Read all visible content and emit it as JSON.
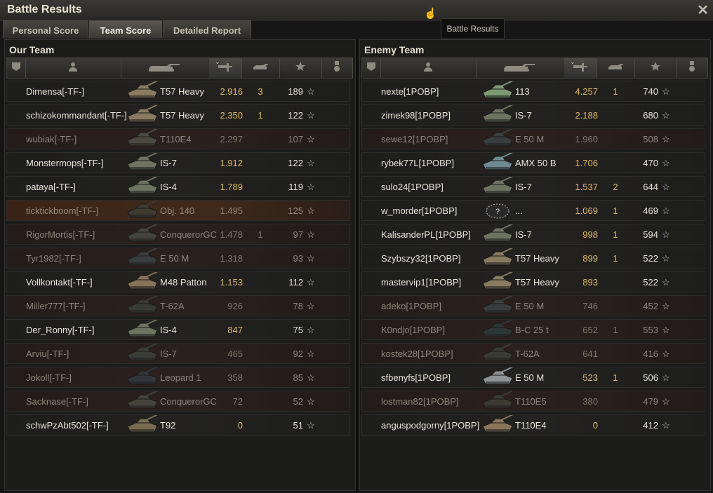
{
  "window": {
    "title": "Battle Results",
    "tooltip": "Battle Results"
  },
  "tabs": [
    {
      "label": "Personal Score",
      "active": false
    },
    {
      "label": "Team Score",
      "active": true
    },
    {
      "label": "Detailed Report",
      "active": false
    }
  ],
  "columns": [
    "rank-icon",
    "player-icon",
    "tank-icon",
    "damage-icon",
    "frags-icon",
    "xp-star-icon",
    "medal-icon"
  ],
  "teams": [
    {
      "title": "Our Team",
      "rows": [
        {
          "name": "Dimensa[-TF-]",
          "tank": "T57 Heavy",
          "damage": "2.916",
          "frags": "3",
          "xp": "189",
          "state": "alive",
          "tank_color": "#8a7a60"
        },
        {
          "name": "schizokommandant[-TF-]",
          "tank": "T57 Heavy",
          "damage": "2.350",
          "frags": "1",
          "xp": "122",
          "state": "alive",
          "tank_color": "#8a7a60"
        },
        {
          "name": "wubiak[-TF-]",
          "tank": "T110E4",
          "damage": "2.297",
          "frags": "",
          "xp": "107",
          "state": "dead",
          "tank_color": "#4a4a40"
        },
        {
          "name": "Monstermops[-TF-]",
          "tank": "IS-7",
          "damage": "1.912",
          "frags": "",
          "xp": "122",
          "state": "alive",
          "tank_color": "#6d7360"
        },
        {
          "name": "pataya[-TF-]",
          "tank": "IS-4",
          "damage": "1.789",
          "frags": "",
          "xp": "119",
          "state": "alive",
          "tank_color": "#6d7360"
        },
        {
          "name": "ticktickboom[-TF-]",
          "tank": "Obj. 140",
          "damage": "1.495",
          "frags": "",
          "xp": "125",
          "state": "me",
          "tank_color": "#3d3a32"
        },
        {
          "name": "RigorMortis[-TF-]",
          "tank": "ConquerorGC",
          "damage": "1.478",
          "frags": "1",
          "xp": "97",
          "state": "dead",
          "tank_color": "#44443c"
        },
        {
          "name": "Tyr1982[-TF-]",
          "tank": "E 50 M",
          "damage": "1.318",
          "frags": "",
          "xp": "93",
          "state": "dead",
          "tank_color": "#3a3d40"
        },
        {
          "name": "Vollkontakt[-TF-]",
          "tank": "M48 Patton",
          "damage": "1.153",
          "frags": "",
          "xp": "112",
          "state": "alive",
          "tank_color": "#8a7258"
        },
        {
          "name": "Miller777[-TF-]",
          "tank": "T-62A",
          "damage": "926",
          "frags": "",
          "xp": "78",
          "state": "dead",
          "tank_color": "#3a3a34"
        },
        {
          "name": "Der_Ronny[-TF-]",
          "tank": "IS-4",
          "damage": "847",
          "frags": "",
          "xp": "75",
          "state": "alive",
          "tank_color": "#6d7360"
        },
        {
          "name": "Arviu[-TF-]",
          "tank": "IS-7",
          "damage": "465",
          "frags": "",
          "xp": "92",
          "state": "dead",
          "tank_color": "#3a3d36"
        },
        {
          "name": "Jokoll[-TF-]",
          "tank": "Leopard 1",
          "damage": "358",
          "frags": "",
          "xp": "85",
          "state": "dead",
          "tank_color": "#32353a"
        },
        {
          "name": "Sacknase[-TF-]",
          "tank": "ConquerorGC",
          "damage": "72",
          "frags": "",
          "xp": "52",
          "state": "dead",
          "tank_color": "#44443c"
        },
        {
          "name": "schwPzAbt502[-TF-]",
          "tank": "T92",
          "damage": "0",
          "frags": "",
          "xp": "51",
          "state": "alive",
          "tank_color": "#7a6c52"
        }
      ]
    },
    {
      "title": "Enemy Team",
      "rows": [
        {
          "name": "nexte[1POBP]",
          "tank": "113",
          "damage": "4.257",
          "frags": "1",
          "xp": "740",
          "state": "alive",
          "tank_color": "#7d9a72"
        },
        {
          "name": "zimek98[1POBP]",
          "tank": "IS-7",
          "damage": "2.188",
          "frags": "",
          "xp": "680",
          "state": "alive",
          "tank_color": "#6d7360"
        },
        {
          "name": "sewe12[1POBP]",
          "tank": "E 50 M",
          "damage": "1.960",
          "frags": "",
          "xp": "508",
          "state": "dead",
          "tank_color": "#3a3d40"
        },
        {
          "name": "rybek77L[1POBP]",
          "tank": "AMX 50 B",
          "damage": "1.706",
          "frags": "",
          "xp": "470",
          "state": "alive",
          "tank_color": "#6e8a92"
        },
        {
          "name": "sulo24[1POBP]",
          "tank": "IS-7",
          "damage": "1.537",
          "frags": "2",
          "xp": "644",
          "state": "alive",
          "tank_color": "#6d7360"
        },
        {
          "name": "w_morder[1POBP]",
          "tank": "...",
          "damage": "1.069",
          "frags": "1",
          "xp": "469",
          "state": "alive",
          "tank_color": "#2a2a2a"
        },
        {
          "name": "KalisanderPL[1POBP]",
          "tank": "IS-7",
          "damage": "998",
          "frags": "1",
          "xp": "594",
          "state": "alive",
          "tank_color": "#6d7360"
        },
        {
          "name": "Szybszy32[1POBP]",
          "tank": "T57 Heavy",
          "damage": "899",
          "frags": "1",
          "xp": "522",
          "state": "alive",
          "tank_color": "#8a7a60"
        },
        {
          "name": "mastervip1[1POBP]",
          "tank": "T57 Heavy",
          "damage": "893",
          "frags": "",
          "xp": "522",
          "state": "alive",
          "tank_color": "#8a7a60"
        },
        {
          "name": "adeko[1POBP]",
          "tank": "E 50 M",
          "damage": "746",
          "frags": "",
          "xp": "452",
          "state": "dead",
          "tank_color": "#3a3d40"
        },
        {
          "name": "K0ndjo[1POBP]",
          "tank": "B-C 25 t",
          "damage": "652",
          "frags": "1",
          "xp": "553",
          "state": "dead",
          "tank_color": "#2f3638"
        },
        {
          "name": "kostek28[1POBP]",
          "tank": "T-62A",
          "damage": "641",
          "frags": "",
          "xp": "416",
          "state": "dead",
          "tank_color": "#3a3a34"
        },
        {
          "name": "sfbenyfs[1POBP]",
          "tank": "E 50 M",
          "damage": "523",
          "frags": "1",
          "xp": "506",
          "state": "alive",
          "tank_color": "#8d9396"
        },
        {
          "name": "lostman82[1POBP]",
          "tank": "T110E5",
          "damage": "380",
          "frags": "",
          "xp": "479",
          "state": "dead",
          "tank_color": "#3c3a33"
        },
        {
          "name": "anguspodgorny[1POBP]",
          "tank": "T110E4",
          "damage": "0",
          "frags": "",
          "xp": "412",
          "state": "alive",
          "tank_color": "#8a7458"
        }
      ]
    }
  ]
}
